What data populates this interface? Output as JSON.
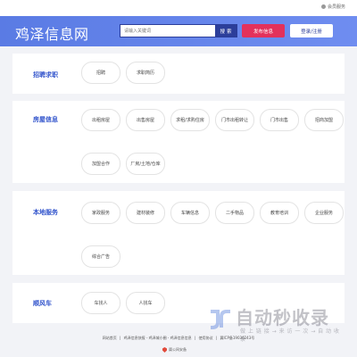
{
  "topbar": {
    "member_label": "会员服务"
  },
  "header": {
    "logo": "鸡泽信息网",
    "search_placeholder": "请输入关键词",
    "search_button": "搜索",
    "post_button": "发布信息",
    "login_button": "登录/注册"
  },
  "categories": [
    {
      "title": "招聘求职",
      "items": [
        "招聘",
        "求职简历"
      ]
    },
    {
      "title": "房屋信息",
      "items": [
        "出租房屋",
        "出售房屋",
        "求租/求购住房",
        "门市出租转让",
        "门市出售",
        "招商加盟",
        "加盟合作",
        "厂房/土地/仓库"
      ]
    },
    {
      "title": "本地服务",
      "items": [
        "家政服务",
        "建材装修",
        "车辆信息",
        "二手物品",
        "教育培训",
        "企业服务",
        "综合广告"
      ]
    },
    {
      "title": "顺风车",
      "items": [
        "车找人",
        "人找车"
      ]
    }
  ],
  "footer": {
    "links": [
      "网站首页",
      "|",
      "鸡泽信息快报 - 鸡泽城小圈 - 鸡泽信息信息",
      "|",
      "使用协议",
      "|",
      "冀ICP备19036243号"
    ],
    "badge": "冀公网安备"
  },
  "watermark": {
    "title": "自动秒收录",
    "subtitle": "做 上 链 接 → 来 访 一 次 → 自 动 收 录"
  }
}
